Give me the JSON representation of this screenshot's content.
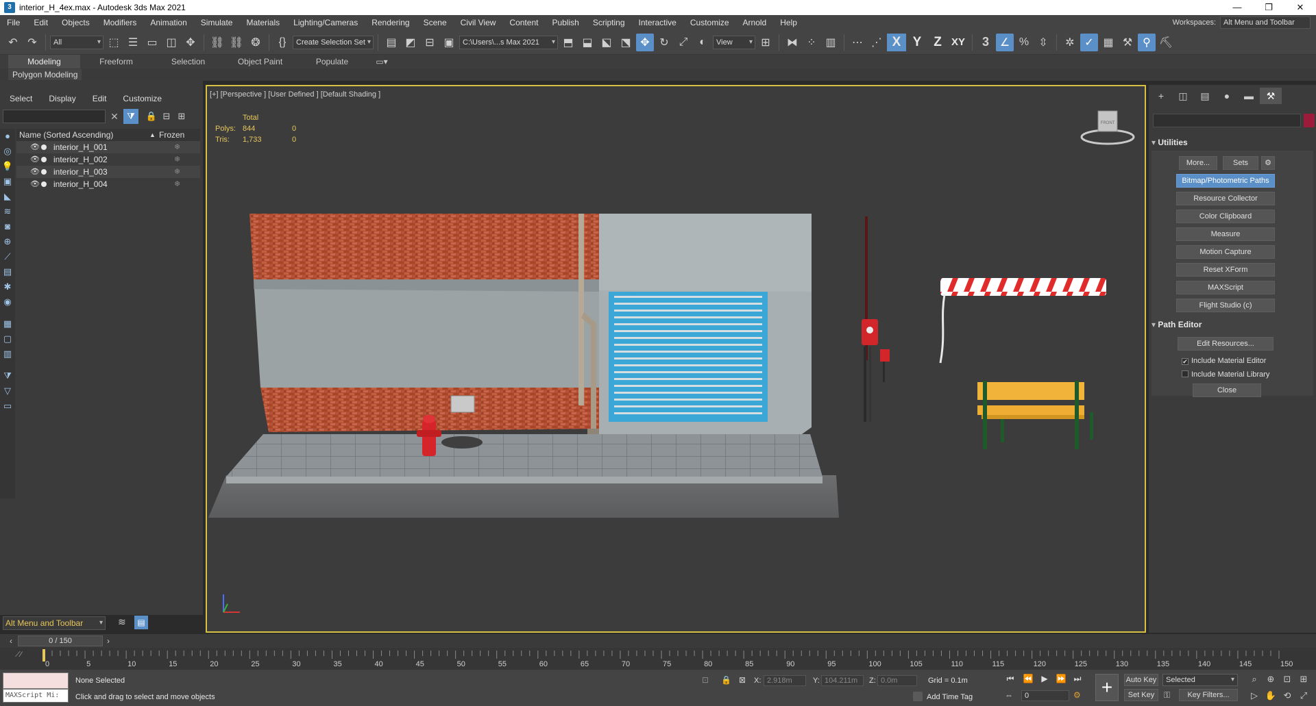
{
  "window": {
    "title": "interior_H_4ex.max - Autodesk 3ds Max 2021",
    "app_icon": "3",
    "controls": [
      "—",
      "❐",
      "✕"
    ]
  },
  "menu": {
    "items": [
      "File",
      "Edit",
      "Objects",
      "Modifiers",
      "Animation",
      "Simulate",
      "Materials",
      "Lighting/Cameras",
      "Rendering",
      "Scene",
      "Civil View",
      "Content",
      "Publish",
      "Scripting",
      "Interactive",
      "Customize",
      "Arnold",
      "Help"
    ],
    "workspaces_label": "Workspaces:",
    "workspaces_value": "Alt Menu and Toolbar"
  },
  "toolbar": {
    "filter_value": "All",
    "selection_set": "Create Selection Set",
    "project_path": "C:\\Users\\...s Max 2021",
    "view_dropdown": "View",
    "axes": [
      "X",
      "Y",
      "Z",
      "XY"
    ],
    "snap_value": "3"
  },
  "ribbon": {
    "tabs": [
      "Modeling",
      "Freeform",
      "Selection",
      "Object Paint",
      "Populate"
    ],
    "active_tab": "Modeling",
    "panel_label": "Polygon Modeling"
  },
  "scene_explorer": {
    "menu": [
      "Select",
      "Display",
      "Edit",
      "Customize"
    ],
    "col_name": "Name (Sorted Ascending)",
    "sort_arrow": "▲",
    "col_frozen": "Frozen",
    "rows": [
      "interior_H_001",
      "interior_H_002",
      "interior_H_003",
      "interior_H_004"
    ],
    "workspace": "Alt Menu and Toolbar"
  },
  "viewport": {
    "label": "[+] [Perspective ] [User Defined ] [Default Shading ]",
    "stats": {
      "header": "Total",
      "polys_label": "Polys:",
      "polys_total": "844",
      "polys_sel": "0",
      "tris_label": "Tris:",
      "tris_total": "1,733",
      "tris_sel": "0"
    },
    "viewcube_label": "FRONT"
  },
  "command_panel": {
    "utilities_title": "Utilities",
    "more_label": "More...",
    "sets_label": "Sets",
    "buttons": [
      "Bitmap/Photometric Paths",
      "Resource Collector",
      "Color Clipboard",
      "Measure",
      "Motion Capture",
      "Reset XForm",
      "MAXScript",
      "Flight Studio (c)"
    ],
    "path_editor_title": "Path Editor",
    "edit_resources": "Edit Resources...",
    "include_material_editor": "Include Material Editor",
    "include_material_library": "Include Material Library",
    "close_label": "Close",
    "swatch_color": "#9c1b3b"
  },
  "timeline": {
    "frame_display": "0 / 150",
    "tick_labels": [
      "0",
      "5",
      "10",
      "15",
      "20",
      "25",
      "30",
      "35",
      "40",
      "45",
      "50",
      "55",
      "60",
      "65",
      "70",
      "75",
      "80",
      "85",
      "90",
      "95",
      "100",
      "105",
      "110",
      "115",
      "120",
      "125",
      "130",
      "135",
      "140",
      "145",
      "150"
    ]
  },
  "status": {
    "maxscript_placeholder": "MAXScript Mi:",
    "selection": "None Selected",
    "prompt": "Click and drag to select and move objects",
    "x_label": "X:",
    "x_value": "2.918m",
    "y_label": "Y:",
    "y_value": "104.211m",
    "z_label": "Z:",
    "z_value": "0.0m",
    "grid": "Grid = 0.1m",
    "add_time_tag": "Add Time Tag",
    "frame_value": "0",
    "auto_key": "Auto Key",
    "set_key": "Set Key",
    "selected": "Selected",
    "key_filters": "Key Filters..."
  }
}
